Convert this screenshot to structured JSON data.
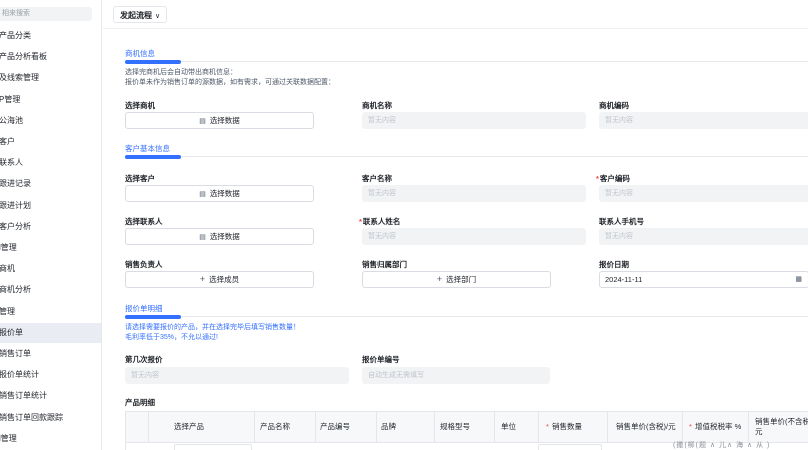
{
  "sidebar": {
    "search_placeholder": "相来搜索",
    "items": [
      {
        "label": "产品分类"
      },
      {
        "label": "产品分析看板"
      },
      {
        "label": "及线索管理"
      },
      {
        "label": "P管理"
      },
      {
        "label": "公海池"
      },
      {
        "label": "客户"
      },
      {
        "label": "联系人"
      },
      {
        "label": "跟进记录"
      },
      {
        "label": "跟进计划"
      },
      {
        "label": "客户分析"
      },
      {
        "label": "l管理"
      },
      {
        "label": "商机"
      },
      {
        "label": "商机分析"
      },
      {
        "label": "管理"
      },
      {
        "label": "报价单"
      },
      {
        "label": "销售订单"
      },
      {
        "label": "报价单统计"
      },
      {
        "label": "销售订单统计"
      },
      {
        "label": "销售订单回款跟踪"
      },
      {
        "label": "l管理"
      }
    ],
    "active_index": 14
  },
  "topbar": {
    "flow_label": "发起流程"
  },
  "sections": {
    "opportunity": {
      "title": "商机信息",
      "desc_lines": [
        "选择完商机后会自动带出商机信息：",
        "报价单未作为销售订单的源数据，如有需求，可通过关联数据配置："
      ],
      "select_label": "选择商机",
      "select_btn": "选择数据",
      "name_label": "商机名称",
      "name_value": "暂无内容",
      "code_label": "商机编码",
      "code_value": "暂无内容"
    },
    "customer": {
      "title": "客户基本信息",
      "select_customer_label": "选择客户",
      "select_btn": "选择数据",
      "customer_name_label": "客户名称",
      "customer_name_value": "暂无内容",
      "customer_code_label": "客户编码",
      "customer_code_value": "暂无内容",
      "select_contact_label": "选择联系人",
      "contact_btn": "选择数据",
      "contact_name_label": "联系人姓名",
      "contact_name_value": "暂无内容",
      "contact_phone_label": "联系人手机号",
      "contact_phone_value": "暂无内容",
      "owner_label": "销售负责人",
      "owner_btn": "选择成员",
      "dept_label": "销售归属部门",
      "dept_btn": "选择部门",
      "date_label": "报价日期",
      "date_value": "2024-11-11"
    },
    "quote": {
      "title": "报价单明细",
      "desc1": "请选择需要报价的产品，并在选择完毕后填写销售数量！",
      "desc2": "毛利率低于35%，不允以通过!",
      "round_label": "第几次报价",
      "round_value": "暂无内容",
      "number_label": "报价单编号",
      "number_value": "自动生成无需填写"
    }
  },
  "product_table": {
    "title": "产品明细",
    "columns": [
      "选择产品",
      "产品名称",
      "产品编号",
      "品牌",
      "规格型号",
      "单位",
      "销售数量",
      "销售单价(含税)/元",
      "增值税税率 %",
      "销售单价(不含税)/元"
    ],
    "required": [
      false,
      false,
      false,
      false,
      false,
      false,
      true,
      false,
      true,
      false
    ]
  },
  "footer_fragment": "(撒(柳(题 ∧ 儿∧ 海 ∧ 从 )",
  "colors": {
    "accent": "#3370ff",
    "required": "#f53f3f"
  }
}
